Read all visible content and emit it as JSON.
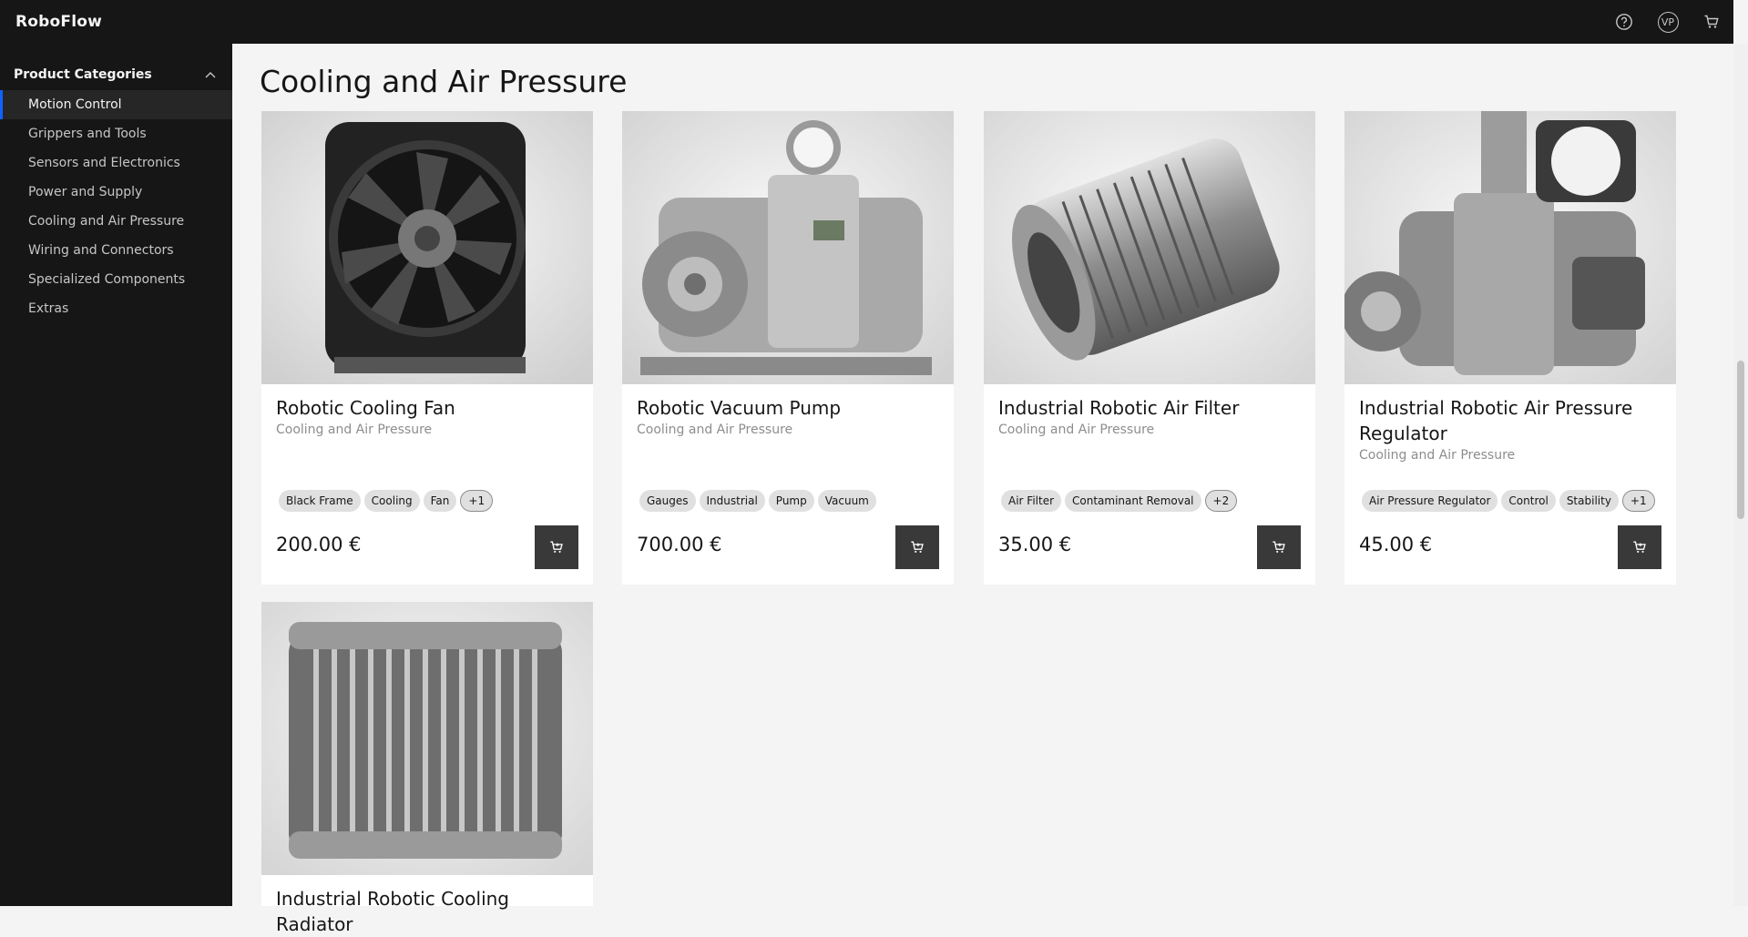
{
  "app": {
    "title": "RoboFlow"
  },
  "header": {
    "help_icon": "help-icon",
    "avatar_initials": "VP",
    "cart_icon": "cart-icon"
  },
  "sidebar": {
    "header": "Product Categories",
    "items": [
      {
        "label": "Motion Control",
        "active": true
      },
      {
        "label": "Grippers and Tools"
      },
      {
        "label": "Sensors and Electronics"
      },
      {
        "label": "Power and Supply"
      },
      {
        "label": "Cooling and Air Pressure"
      },
      {
        "label": "Wiring and Connectors"
      },
      {
        "label": "Specialized Components"
      },
      {
        "label": "Extras"
      }
    ]
  },
  "main": {
    "title": "Cooling and Air Pressure",
    "products": [
      {
        "name": "Robotic Cooling Fan",
        "category": "Cooling and Air Pressure",
        "tags": [
          "Black Frame",
          "Cooling",
          "Fan"
        ],
        "more": "+1",
        "price": "200.00 €",
        "image": "fan"
      },
      {
        "name": "Robotic Vacuum Pump",
        "category": "Cooling and Air Pressure",
        "tags": [
          "Gauges",
          "Industrial",
          "Pump",
          "Vacuum"
        ],
        "more": "",
        "price": "700.00 €",
        "image": "pump"
      },
      {
        "name": "Industrial Robotic Air Filter",
        "category": "Cooling and Air Pressure",
        "tags": [
          "Air Filter",
          "Contaminant Removal"
        ],
        "more": "+2",
        "price": "35.00 €",
        "image": "filter"
      },
      {
        "name": "Industrial Robotic Air Pressure Regulator",
        "category": "Cooling and Air Pressure",
        "tags": [
          "Air Pressure Regulator",
          "Control",
          "Stability"
        ],
        "more": "+1",
        "price": "45.00 €",
        "image": "regulator"
      },
      {
        "name": "Industrial Robotic Cooling Radiator",
        "category": "Cooling and Air Pressure",
        "tags": [],
        "more": "",
        "price": "",
        "image": "radiator"
      }
    ]
  }
}
